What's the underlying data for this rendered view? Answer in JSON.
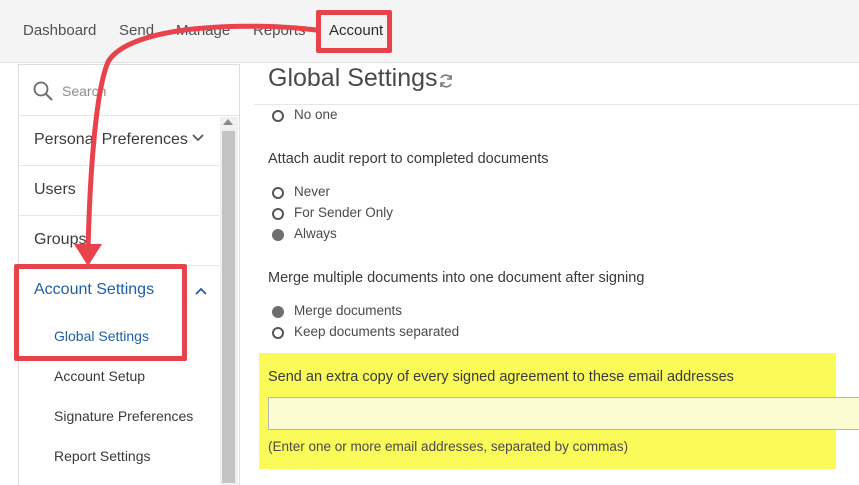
{
  "nav": {
    "items": [
      {
        "label": "Dashboard"
      },
      {
        "label": "Send"
      },
      {
        "label": "Manage"
      },
      {
        "label": "Reports"
      },
      {
        "label": "Account"
      }
    ]
  },
  "sidebar": {
    "search_label": "Search",
    "items": [
      {
        "label": "Personal Preferences"
      },
      {
        "label": "Users"
      },
      {
        "label": "Groups"
      },
      {
        "label": "Account Settings"
      }
    ],
    "subitems": [
      {
        "label": "Global Settings"
      },
      {
        "label": "Account Setup"
      },
      {
        "label": "Signature Preferences"
      },
      {
        "label": "Report Settings"
      }
    ]
  },
  "main": {
    "title": "Global Settings",
    "top_option": {
      "label": "No one",
      "checked": false
    },
    "audit": {
      "heading": "Attach audit report to completed documents",
      "options": [
        {
          "label": "Never",
          "checked": false
        },
        {
          "label": "For Sender Only",
          "checked": false
        },
        {
          "label": "Always",
          "checked": true
        }
      ]
    },
    "merge": {
      "heading": "Merge multiple documents into one document after signing",
      "options": [
        {
          "label": "Merge documents",
          "checked": true
        },
        {
          "label": "Keep documents separated",
          "checked": false
        }
      ]
    },
    "extra_copy": {
      "heading": "Send an extra copy of every signed agreement to these email addresses",
      "value": "",
      "help": "(Enter one or more email addresses, separated by commas)"
    }
  },
  "colors": {
    "annotation": "#e8424d",
    "highlight": "#fafa58",
    "link_blue": "#1f5fa8"
  }
}
